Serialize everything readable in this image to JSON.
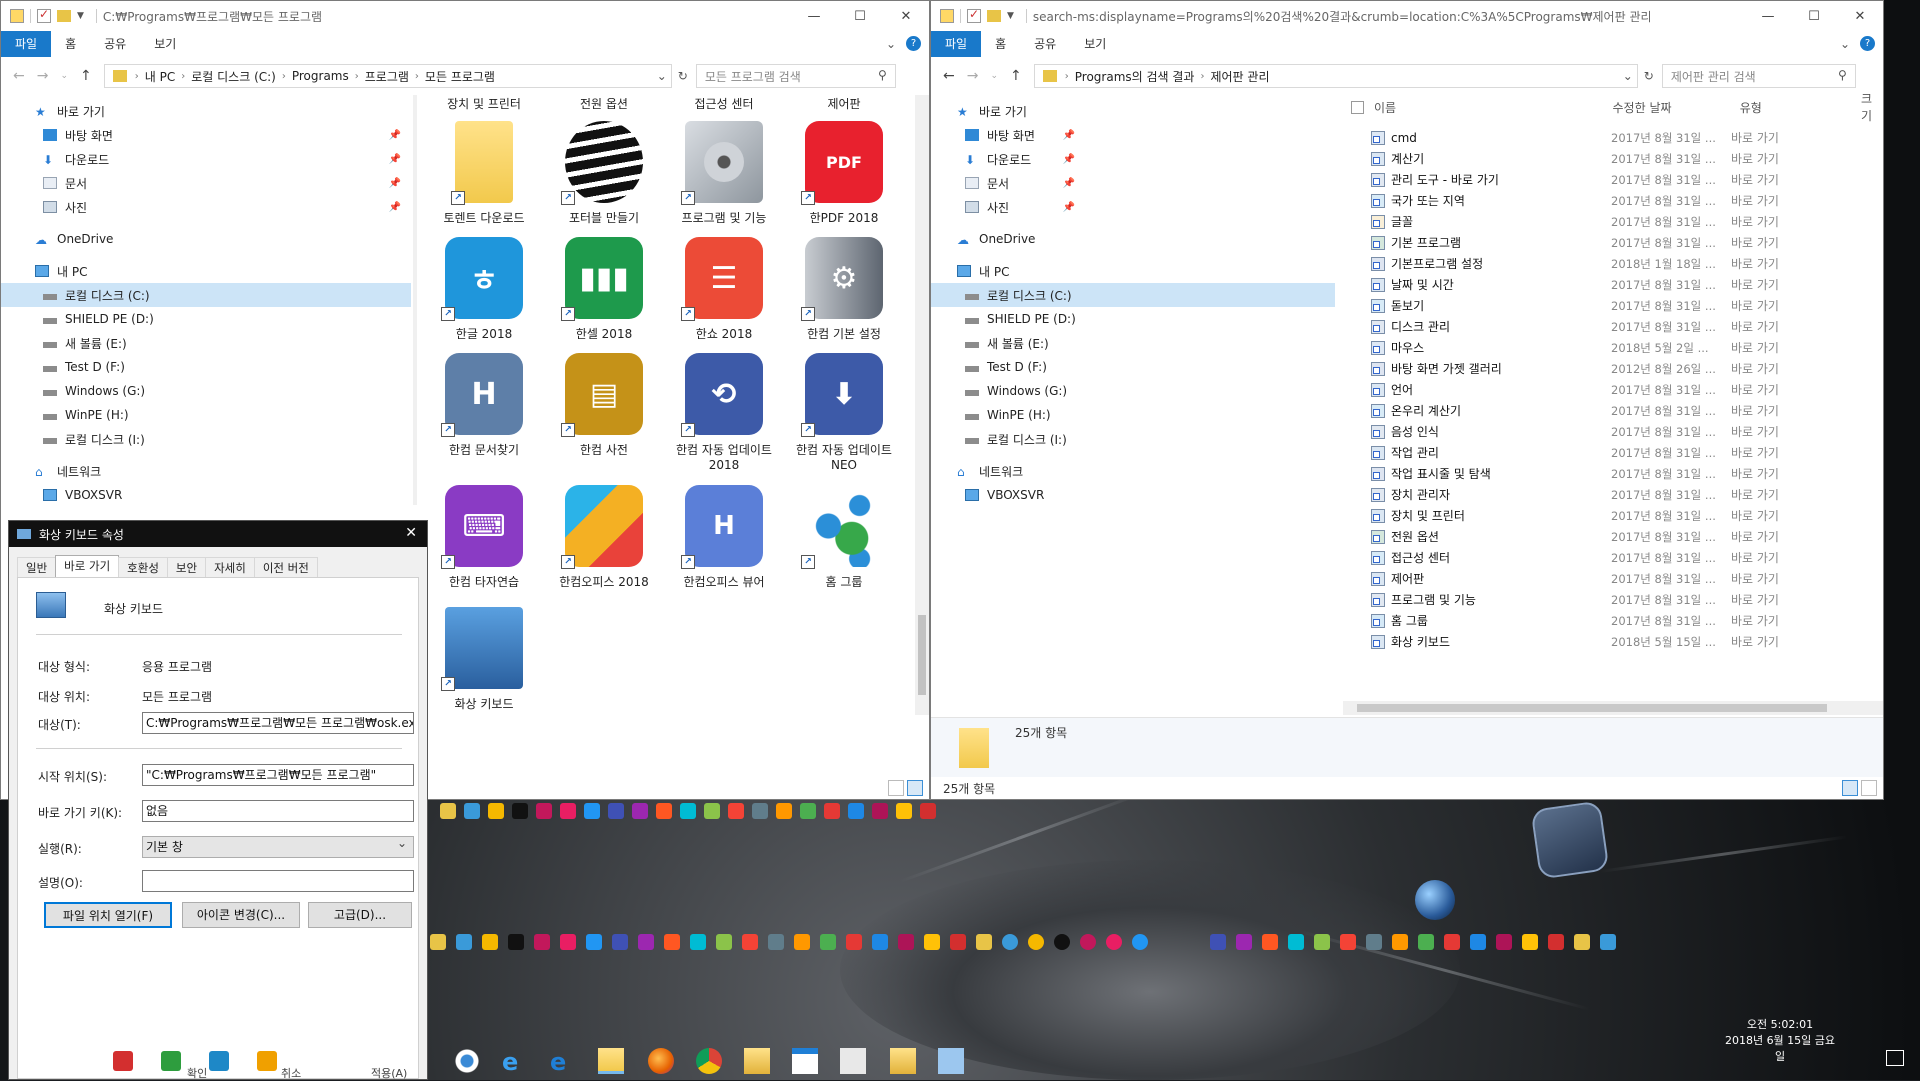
{
  "left_window": {
    "title_path": "C:₩Programs₩프로그램₩모든 프로그램",
    "ribbon_tabs": [
      "파일",
      "홈",
      "공유",
      "보기"
    ],
    "breadcrumb": [
      "내 PC",
      "로컬 디스크 (C:)",
      "Programs",
      "프로그램",
      "모든 프로그램"
    ],
    "search_placeholder": "모든 프로그램 검색",
    "nav": {
      "quick": "바로 가기",
      "desktop": "바탕 화면",
      "downloads": "다운로드",
      "documents": "문서",
      "pictures": "사진",
      "onedrive": "OneDrive",
      "pc": "내 PC",
      "drives": [
        "로컬 디스크 (C:)",
        "SHIELD PE (D:)",
        "새 볼륨 (E:)",
        "Test D (F:)",
        "Windows (G:)",
        "WinPE (H:)",
        "로컬 디스크 (I:)"
      ],
      "network": "네트워크",
      "vbox": "VBOXSVR"
    },
    "top_labels": [
      "장치 및 프린터",
      "전원 옵션",
      "접근성 센터",
      "제어판"
    ],
    "tiles": [
      "토렌트 다운로드",
      "포터블 만들기",
      "프로그램 및 기능",
      "한PDF 2018",
      "한글 2018",
      "한셀 2018",
      "한쇼 2018",
      "한컴 기본 설정",
      "한컴 문서찾기",
      "한컴 사전",
      "한컴 자동 업데이트 2018",
      "한컴 자동 업데이트 NEO",
      "한컴 타자연습",
      "한컴오피스 2018",
      "한컴오피스 뷰어",
      "홈 그룹",
      "화상 키보드"
    ]
  },
  "right_window": {
    "title_path": "search-ms:displayname=Programs의%20검색%20결과&crumb=location:C%3A%5CPrograms₩제어판 관리",
    "ribbon_tabs": [
      "파일",
      "홈",
      "공유",
      "보기"
    ],
    "breadcrumb": [
      "Programs의 검색 결과",
      "제어판 관리"
    ],
    "search_placeholder": "제어판 관리 검색",
    "columns": [
      "이름",
      "수정한 날짜",
      "유형",
      "크기"
    ],
    "files": [
      {
        "name": "cmd",
        "date": "2017년 8월 31일 ...",
        "type": "바로 가기"
      },
      {
        "name": "계산기",
        "date": "2017년 8월 31일 ...",
        "type": "바로 가기"
      },
      {
        "name": "관리 도구 - 바로 가기",
        "date": "2017년 8월 31일 ...",
        "type": "바로 가기"
      },
      {
        "name": "국가 또는 지역",
        "date": "2017년 8월 31일 ...",
        "type": "바로 가기"
      },
      {
        "name": "글꼴",
        "date": "2017년 8월 31일 ...",
        "type": "바로 가기"
      },
      {
        "name": "기본 프로그램",
        "date": "2017년 8월 31일 ...",
        "type": "바로 가기"
      },
      {
        "name": "기본프로그램 설정",
        "date": "2018년 1월 18일 ...",
        "type": "바로 가기"
      },
      {
        "name": "날짜 및 시간",
        "date": "2017년 8월 31일 ...",
        "type": "바로 가기"
      },
      {
        "name": "돋보기",
        "date": "2017년 8월 31일 ...",
        "type": "바로 가기"
      },
      {
        "name": "디스크 관리",
        "date": "2017년 8월 31일 ...",
        "type": "바로 가기"
      },
      {
        "name": "마우스",
        "date": "2018년 5월 2일 ...",
        "type": "바로 가기"
      },
      {
        "name": "바탕 화면 가젯 갤러리",
        "date": "2012년 8월 26일 ...",
        "type": "바로 가기"
      },
      {
        "name": "언어",
        "date": "2017년 8월 31일 ...",
        "type": "바로 가기"
      },
      {
        "name": "온우리 계산기",
        "date": "2017년 8월 31일 ...",
        "type": "바로 가기"
      },
      {
        "name": "음성 인식",
        "date": "2017년 8월 31일 ...",
        "type": "바로 가기"
      },
      {
        "name": "작업 관리",
        "date": "2017년 8월 31일 ...",
        "type": "바로 가기"
      },
      {
        "name": "작업 표시줄 및 탐색",
        "date": "2017년 8월 31일 ...",
        "type": "바로 가기"
      },
      {
        "name": "장치 관리자",
        "date": "2017년 8월 31일 ...",
        "type": "바로 가기"
      },
      {
        "name": "장치 및 프린터",
        "date": "2017년 8월 31일 ...",
        "type": "바로 가기"
      },
      {
        "name": "전원 옵션",
        "date": "2017년 8월 31일 ...",
        "type": "바로 가기"
      },
      {
        "name": "접근성 센터",
        "date": "2017년 8월 31일 ...",
        "type": "바로 가기"
      },
      {
        "name": "제어판",
        "date": "2017년 8월 31일 ...",
        "type": "바로 가기"
      },
      {
        "name": "프로그램 및 기능",
        "date": "2017년 8월 31일 ...",
        "type": "바로 가기"
      },
      {
        "name": "홈 그룹",
        "date": "2017년 8월 31일 ...",
        "type": "바로 가기"
      },
      {
        "name": "화상 키보드",
        "date": "2018년 5월 15일 ...",
        "type": "바로 가기"
      }
    ],
    "summary": "25개 항목",
    "status": "25개 항목"
  },
  "dialog": {
    "title": "화상 키보드 속성",
    "tabs": [
      "일반",
      "바로 가기",
      "호환성",
      "보안",
      "자세히",
      "이전 버전"
    ],
    "name": "화상 키보드",
    "labels": {
      "type": "대상 형식:",
      "location": "대상 위치:",
      "target": "대상(T):",
      "start": "시작 위치(S):",
      "hotkey": "바로 가기 키(K):",
      "run": "실행(R):",
      "comment": "설명(O):"
    },
    "values": {
      "type": "응용 프로그램",
      "location": "모든 프로그램",
      "target": "C:₩Programs₩프로그램₩모든 프로그램₩osk.exe\"",
      "start": "\"C:₩Programs₩프로그램₩모든 프로그램\"",
      "hotkey": "없음",
      "run": "기본 창",
      "comment": ""
    },
    "buttons": [
      "파일 위치 열기(F)",
      "아이콘 변경(C)...",
      "고급(D)..."
    ],
    "bottom_buttons": [
      "확인",
      "취소",
      "적용(A)"
    ]
  },
  "taskbar": {
    "time": "오전 5:02:01",
    "date": "2018년 6월 15일 금요일"
  }
}
